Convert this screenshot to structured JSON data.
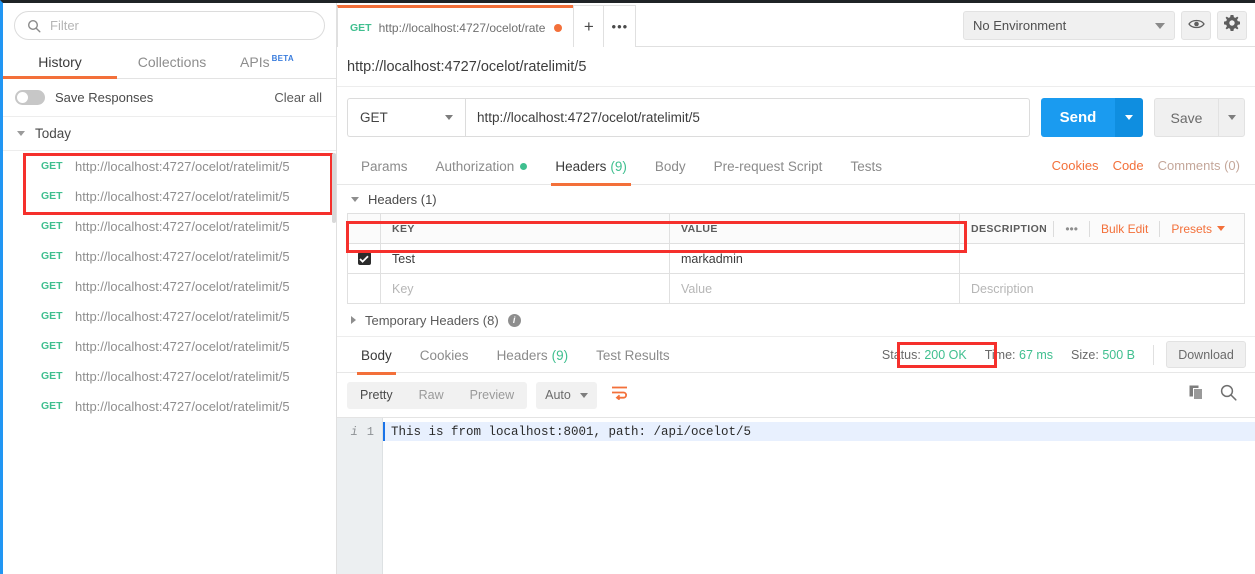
{
  "sidebar": {
    "filter": {
      "placeholder": "Filter",
      "value": "",
      "icon": "search-icon"
    },
    "tabs": [
      {
        "label": "History",
        "active": true
      },
      {
        "label": "Collections",
        "active": false
      },
      {
        "label": "APIs",
        "badge": "BETA",
        "active": false
      }
    ],
    "save_responses_label": "Save Responses",
    "clear_all_label": "Clear all",
    "group_label": "Today",
    "history": [
      {
        "method": "GET",
        "url": "http://localhost:4727/ocelot/ratelimit/5"
      },
      {
        "method": "GET",
        "url": "http://localhost:4727/ocelot/ratelimit/5"
      },
      {
        "method": "GET",
        "url": "http://localhost:4727/ocelot/ratelimit/5"
      },
      {
        "method": "GET",
        "url": "http://localhost:4727/ocelot/ratelimit/5"
      },
      {
        "method": "GET",
        "url": "http://localhost:4727/ocelot/ratelimit/5"
      },
      {
        "method": "GET",
        "url": "http://localhost:4727/ocelot/ratelimit/5"
      },
      {
        "method": "GET",
        "url": "http://localhost:4727/ocelot/ratelimit/5"
      },
      {
        "method": "GET",
        "url": "http://localhost:4727/ocelot/ratelimit/5"
      },
      {
        "method": "GET",
        "url": "http://localhost:4727/ocelot/ratelimit/5"
      }
    ]
  },
  "tabbar": {
    "open_tab": {
      "method": "GET",
      "label": "http://localhost:4727/ocelot/rate",
      "unsaved": true
    },
    "new_tab_label": "+",
    "more_tabs_label": "•••",
    "environment": "No Environment",
    "eye_icon": "eye-icon",
    "gear_icon": "gear-icon"
  },
  "request": {
    "url_heading": "http://localhost:4727/ocelot/ratelimit/5",
    "method": "GET",
    "url": "http://localhost:4727/ocelot/ratelimit/5",
    "send_label": "Send",
    "save_label": "Save",
    "tabs": [
      {
        "label": "Params",
        "active": false
      },
      {
        "label": "Authorization",
        "active": false,
        "dot": true
      },
      {
        "label": "Headers",
        "count": "(9)",
        "active": true
      },
      {
        "label": "Body",
        "active": false
      },
      {
        "label": "Pre-request Script",
        "active": false
      },
      {
        "label": "Tests",
        "active": false
      }
    ],
    "right_links": [
      {
        "label": "Cookies",
        "muted": false
      },
      {
        "label": "Code",
        "muted": false
      },
      {
        "label": "Comments (0)",
        "muted": true
      }
    ]
  },
  "headers": {
    "section_title": "Headers (1)",
    "columns": [
      "KEY",
      "VALUE",
      "DESCRIPTION"
    ],
    "actions": {
      "more": "•••",
      "bulk_edit": "Bulk Edit",
      "presets": "Presets"
    },
    "rows": [
      {
        "checked": true,
        "key": "Test",
        "value": "markadmin",
        "description": ""
      }
    ],
    "placeholder_row": {
      "key": "Key",
      "value": "Value",
      "description": "Description"
    },
    "temporary_title": "Temporary Headers (8)"
  },
  "response": {
    "tabs": [
      {
        "label": "Body",
        "active": true
      },
      {
        "label": "Cookies",
        "active": false
      },
      {
        "label": "Headers",
        "count": "(9)",
        "active": false
      },
      {
        "label": "Test Results",
        "active": false
      }
    ],
    "status_label": "Status:",
    "status_value": "200 OK",
    "time_label": "Time:",
    "time_value": "67 ms",
    "size_label": "Size:",
    "size_value": "500 B",
    "download_label": "Download",
    "view_modes": [
      {
        "label": "Pretty",
        "active": true
      },
      {
        "label": "Raw",
        "active": false
      },
      {
        "label": "Preview",
        "active": false
      }
    ],
    "format": "Auto",
    "wrap_icon": "word-wrap-icon",
    "copy_icon": "copy-icon",
    "search_icon": "search-icon",
    "gutter_info_icon": "i",
    "line_number": "1",
    "body_text": "This is from localhost:8001, path: /api/ocelot/5"
  },
  "colors": {
    "accent_orange": "#f3703a",
    "method_green": "#3fbf8f",
    "send_blue": "#1a9bf0",
    "annotation_red": "#f5302c",
    "left_rail_blue": "#2196f3"
  }
}
